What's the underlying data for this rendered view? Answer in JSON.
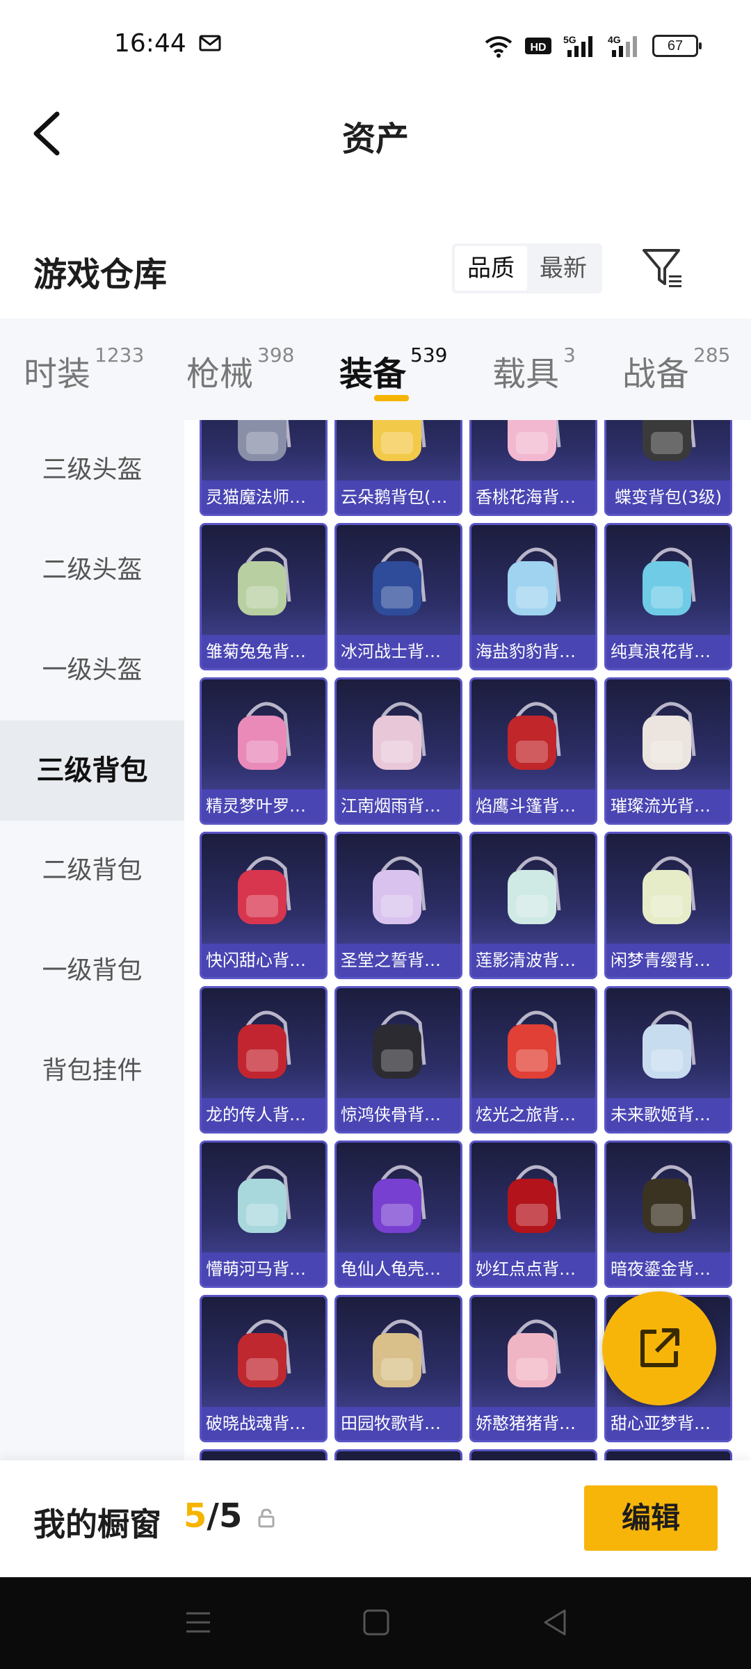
{
  "status_bar": {
    "time": "16:44",
    "battery": "67",
    "icons": [
      "mail-icon",
      "wifi-icon",
      "hd-icon",
      "5g-signal-icon",
      "4g-signal-icon",
      "battery-icon"
    ]
  },
  "nav": {
    "title": "资产",
    "back_icon": "chevron-left-icon"
  },
  "header": {
    "title": "游戏仓库",
    "sort_options": [
      "品质",
      "最新"
    ],
    "sort_selected": "品质",
    "filter_icon": "filter-icon"
  },
  "tabs": [
    {
      "label": "时装",
      "count": "1233"
    },
    {
      "label": "枪械",
      "count": "398"
    },
    {
      "label": "装备",
      "count": "539",
      "active": true
    },
    {
      "label": "载具",
      "count": "3"
    },
    {
      "label": "战备",
      "count": "285"
    }
  ],
  "sidebar": {
    "items": [
      {
        "label": "三级头盔"
      },
      {
        "label": "二级头盔"
      },
      {
        "label": "一级头盔"
      },
      {
        "label": "三级背包",
        "active": true
      },
      {
        "label": "二级背包"
      },
      {
        "label": "一级背包"
      },
      {
        "label": "背包挂件"
      }
    ]
  },
  "grid": {
    "items": [
      {
        "label": "灵猫魔法师背...",
        "color": "#8a8fa8"
      },
      {
        "label": "云朵鹅背包(3...",
        "color": "#f3c94a"
      },
      {
        "label": "香桃花海背包...",
        "color": "#f2b8cf"
      },
      {
        "label": "蝶变背包(3级)",
        "color": "#3a3a3a"
      },
      {
        "label": "雏菊兔兔背包...",
        "color": "#b8cfa2"
      },
      {
        "label": "冰河战士背包...",
        "color": "#2e4c9a"
      },
      {
        "label": "海盐豹豹背包...",
        "color": "#9fd3ef"
      },
      {
        "label": "纯真浪花背包...",
        "color": "#6fcbe6"
      },
      {
        "label": "精灵梦叶罗丽...",
        "color": "#e98ab9"
      },
      {
        "label": "江南烟雨背包...",
        "color": "#e8c8d8"
      },
      {
        "label": "焰鹰斗篷背包...",
        "color": "#c0262a"
      },
      {
        "label": "璀璨流光背包...",
        "color": "#ece4de"
      },
      {
        "label": "快闪甜心背包...",
        "color": "#d8354e"
      },
      {
        "label": "圣堂之誓背包...",
        "color": "#d9c3ee"
      },
      {
        "label": "莲影清波背包...",
        "color": "#cfe9e4"
      },
      {
        "label": "闲梦青缨背包...",
        "color": "#e6ecc8"
      },
      {
        "label": "龙的传人背包...",
        "color": "#c32530"
      },
      {
        "label": "惊鸿侠骨背包...",
        "color": "#2b2b31"
      },
      {
        "label": "炫光之旅背包...",
        "color": "#e04035"
      },
      {
        "label": "未来歌姬背包...",
        "color": "#c8dcef"
      },
      {
        "label": "懵萌河马背包...",
        "color": "#a8d8dc"
      },
      {
        "label": "龟仙人龟壳背...",
        "color": "#7840d0"
      },
      {
        "label": "妙红点点背包...",
        "color": "#b3131b"
      },
      {
        "label": "暗夜鎏金背包...",
        "color": "#3a3322"
      },
      {
        "label": "破晓战魂背包...",
        "color": "#c02830"
      },
      {
        "label": "田园牧歌背包...",
        "color": "#d9c08a"
      },
      {
        "label": "娇憨猪猪背包...",
        "color": "#f0b5c4"
      },
      {
        "label": "甜心亚梦背包...",
        "color": "#e9a4c0"
      },
      {
        "label": "",
        "color": "#4a4a80"
      },
      {
        "label": "",
        "color": "#4a4a80"
      },
      {
        "label": "",
        "color": "#4a4a80"
      },
      {
        "label": "",
        "color": "#4a4a80"
      }
    ]
  },
  "fab": {
    "icon": "share-external-icon"
  },
  "bottom": {
    "showcase_label": "我的橱窗",
    "showcase_current": "5",
    "showcase_sep": "/",
    "showcase_total": "5",
    "lock_icon": "lock-icon",
    "edit_label": "编辑"
  },
  "system_nav": [
    "menu-icon",
    "home-icon",
    "back-icon"
  ],
  "colors": {
    "accent": "#f7b50a",
    "card_border": "#5a56c6",
    "card_label_bg": "#4a46b4"
  }
}
